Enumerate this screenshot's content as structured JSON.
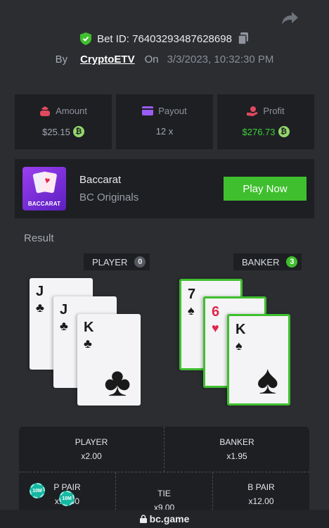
{
  "header": {
    "bet_id": "Bet ID: 76403293487628698",
    "by_label": "By",
    "user": "CryptoETV",
    "on_label": "On",
    "date": "3/3/2023, 10:32:30 PM"
  },
  "stats": [
    {
      "label": "Amount",
      "value": "$25.15",
      "icon": "money-bag-icon",
      "color": "#e0495e"
    },
    {
      "label": "Payout",
      "value": "12 x",
      "icon": "wallet-icon",
      "color": "#9b5cf5"
    },
    {
      "label": "Profit",
      "value": "$276.73",
      "icon": "hand-coin-icon",
      "color": "#e0495e"
    }
  ],
  "game": {
    "name": "Baccarat",
    "provider": "BC Originals",
    "thumb_label": "BACCARAT",
    "play_label": "Play Now"
  },
  "result": {
    "label": "Result",
    "player": {
      "label": "PLAYER",
      "score": "0",
      "cards": [
        {
          "rank": "J",
          "suit": "♣"
        },
        {
          "rank": "J",
          "suit": "♣"
        },
        {
          "rank": "K",
          "suit": "♣"
        }
      ]
    },
    "banker": {
      "label": "BANKER",
      "score": "3",
      "cards": [
        {
          "rank": "7",
          "suit": "♠"
        },
        {
          "rank": "6",
          "suit": "♥"
        },
        {
          "rank": "K",
          "suit": "♠"
        }
      ]
    }
  },
  "bets": {
    "player": {
      "label": "PLAYER",
      "odds": "x2.00"
    },
    "banker": {
      "label": "BANKER",
      "odds": "x1.95"
    },
    "p_pair": {
      "label": "P PAIR",
      "odds": "x11.00"
    },
    "tie": {
      "label": "TIE",
      "odds": "x9.00"
    },
    "b_pair": {
      "label": "B PAIR",
      "odds": "x12.00"
    },
    "chip_label": "10M"
  },
  "footer": {
    "site": "bc.game"
  },
  "colors": {
    "accent_green": "#3fbf2e",
    "profit_green": "#3fd13b",
    "panel": "#1d1f23",
    "background": "#2b2d31"
  }
}
